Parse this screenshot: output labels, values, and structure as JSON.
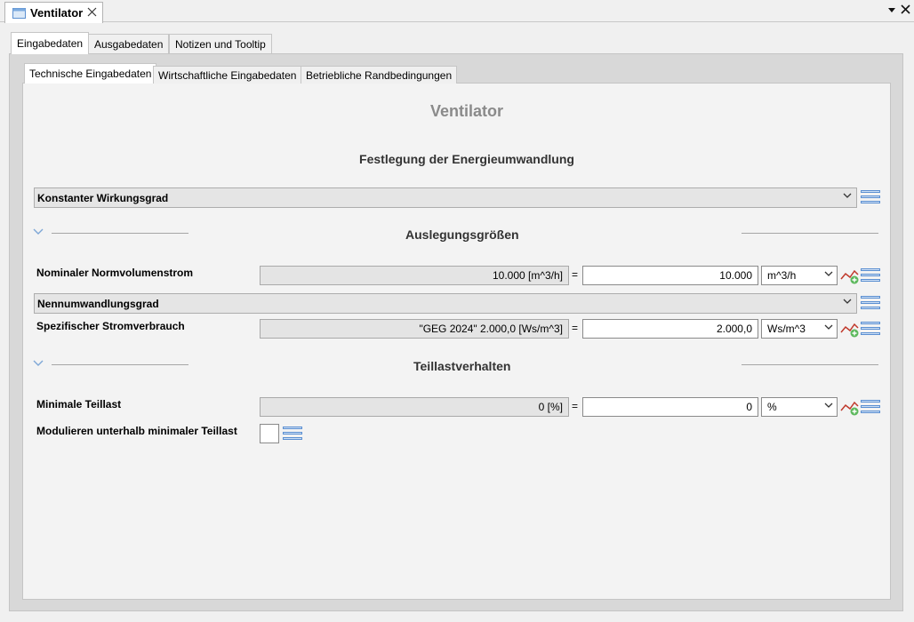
{
  "window": {
    "title": "Ventilator",
    "menu_icon": "chevron-down-icon",
    "close_icon": "close-icon"
  },
  "outer_tabs": [
    {
      "label": "Eingabedaten",
      "active": true
    },
    {
      "label": "Ausgabedaten",
      "active": false
    },
    {
      "label": "Notizen und Tooltip",
      "active": false
    }
  ],
  "inner_tabs": [
    {
      "label": "Technische Eingabedaten",
      "active": true
    },
    {
      "label": "Wirtschaftliche Eingabedaten",
      "active": false
    },
    {
      "label": "Betriebliche Randbedingungen",
      "active": false
    }
  ],
  "page": {
    "title": "Ventilator",
    "subtitle": "Festlegung der Energieumwandlung",
    "conversion_mode": "Konstanter Wirkungsgrad"
  },
  "sections": {
    "design": "Auslegungsgrößen",
    "part_load": "Teillastverhalten"
  },
  "fields": {
    "nominal_flow": {
      "label": "Nominaler Normvolumenstrom",
      "formula": "10.000 [m^3/h]",
      "equals": "=",
      "value": "10.000",
      "unit": "m^3/h"
    },
    "efficiency_combo": "Nennumwandlungsgrad",
    "specific_power": {
      "label": "Spezifischer Stromverbrauch",
      "formula": "\"GEG 2024\" 2.000,0 [Ws/m^3]",
      "equals": "=",
      "value": "2.000,0",
      "unit": "Ws/m^3"
    },
    "min_part_load": {
      "label": "Minimale Teillast",
      "formula": "0 [%]",
      "equals": "=",
      "value": "0",
      "unit": "%"
    },
    "modulate_below": {
      "label": "Modulieren unterhalb minimaler Teillast",
      "checked": false
    }
  },
  "colors": {
    "accent": "#5b8fd1",
    "title_gray": "#8a8a8a"
  }
}
